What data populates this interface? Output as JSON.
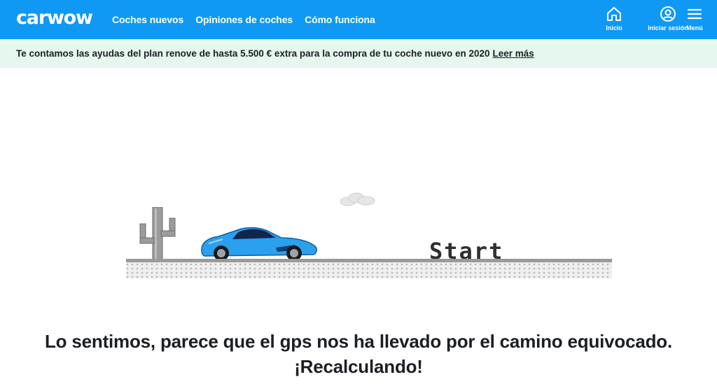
{
  "header": {
    "logo": "carwow",
    "nav": [
      "Coches nuevos",
      "Opiniones de coches",
      "Cómo funciona"
    ],
    "right": {
      "home_label": "Inicio",
      "login_label": "Iniciar sesión",
      "menu_label": "Menú"
    }
  },
  "banner": {
    "text": "Te contamos las ayudas del plan renove de hasta 5.500 € extra para la compra de tu coche nuevo en 2020",
    "link": "Leer más"
  },
  "game": {
    "start_label": "Start"
  },
  "message": {
    "line1": "Lo sentimos, parece que el gps nos ha llevado por el camino equivocado.",
    "line2": "¡Recalculando!"
  },
  "colors": {
    "brand_blue": "#0f99f5",
    "banner_bg": "#e6f7ee",
    "car_blue": "#2aa0ee"
  }
}
